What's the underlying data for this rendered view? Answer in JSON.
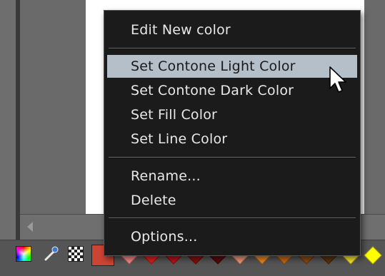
{
  "context_menu": {
    "items": [
      {
        "label": "Edit New color"
      },
      {
        "label": "Set Contone Light Color",
        "highlighted": true
      },
      {
        "label": "Set Contone Dark Color"
      },
      {
        "label": "Set Fill Color"
      },
      {
        "label": "Set Line Color"
      },
      {
        "label": "Rename..."
      },
      {
        "label": "Delete"
      },
      {
        "label": "Options..."
      }
    ]
  },
  "palette": {
    "icons": [
      "color-wheel-icon",
      "eyedropper-icon",
      "no-color-icon"
    ],
    "selected_swatch": "#cc4433",
    "swatches": [
      "#ff8a8a",
      "#e0201c",
      "#c0101a",
      "#8a0e0e",
      "#5a0a06",
      "#f59a7a",
      "#ee8a20",
      "#c86a14",
      "#8a4a10",
      "#5a320a",
      "#ffea2a",
      "#ffff00"
    ]
  },
  "colors": {
    "menu_background": "#1b1b1b",
    "menu_text": "#e8e8e8",
    "menu_highlight": "#b4bfca",
    "chrome_gray": "#6a6a6a",
    "canvas": "#ffffff"
  }
}
